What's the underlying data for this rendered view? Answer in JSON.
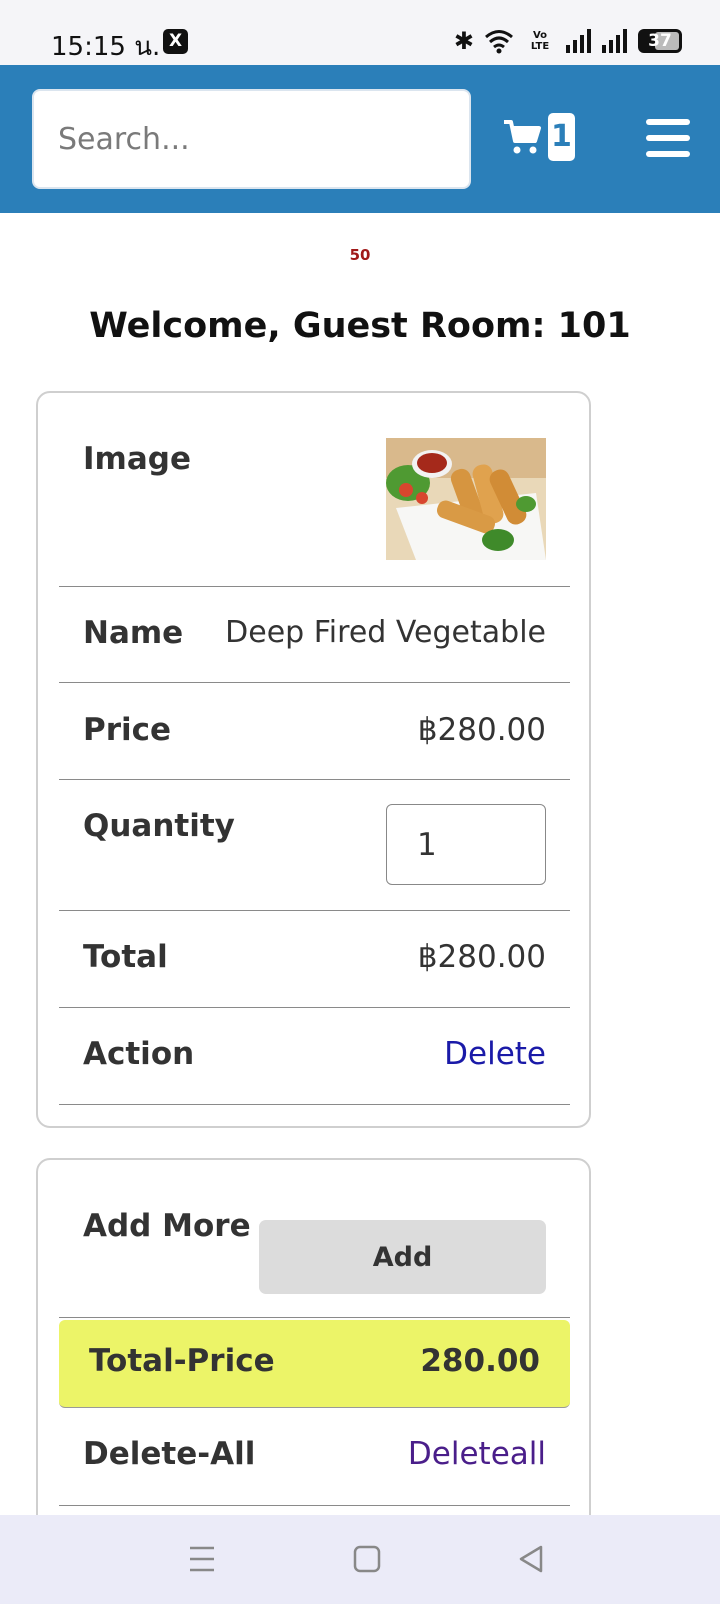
{
  "status_bar": {
    "time": "15:15 น.",
    "x_app_label": "X",
    "volte_label": "Vo LTE",
    "battery": "37"
  },
  "header": {
    "search_placeholder": "Search...",
    "cart_count": "1",
    "icons": [
      "cart-icon",
      "hamburger-menu-icon"
    ],
    "accent_color": "#2b7fb9"
  },
  "page": {
    "counter": "50",
    "welcome": "Welcome, Guest Room: 101"
  },
  "cart_item": {
    "image_label": "Image",
    "name_label": "Name",
    "name_value": "Deep Fired Vegetable",
    "price_label": "Price",
    "price_value": "฿280.00",
    "quantity_label": "Quantity",
    "quantity_value": "1",
    "total_label": "Total",
    "total_value": "฿280.00",
    "action_label": "Action",
    "action_link": "Delete"
  },
  "summary": {
    "add_more_label": "Add More",
    "add_button": "Add",
    "total_price_label": "Total-Price",
    "total_price_value": "280.00",
    "total_highlight_color": "#ecf468",
    "delete_all_label": "Delete-All",
    "delete_all_link": "Deleteall"
  },
  "nav_bar": {
    "icons": [
      "recent-apps-icon",
      "home-icon",
      "back-icon"
    ]
  }
}
